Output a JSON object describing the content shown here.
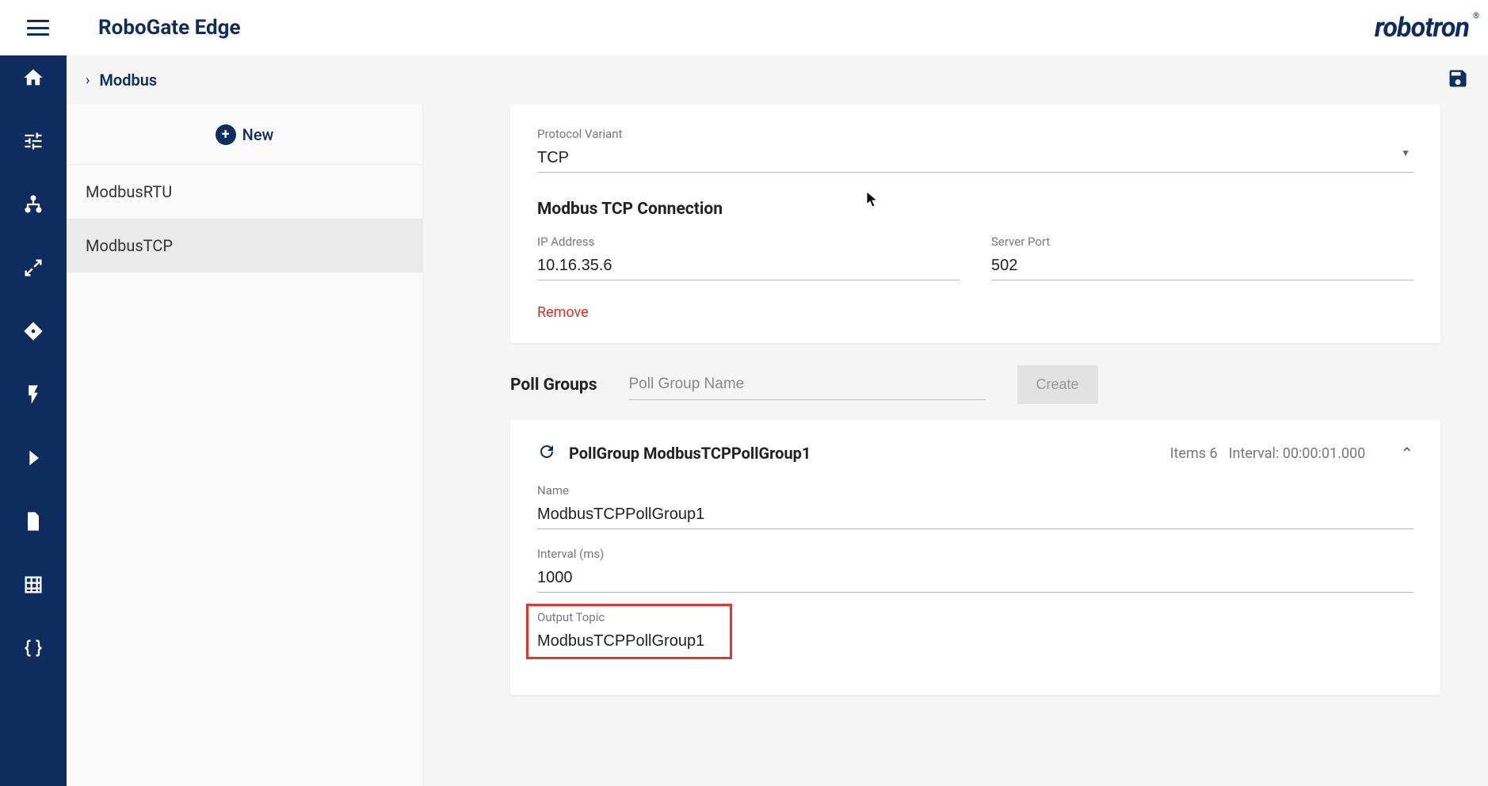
{
  "app_title": "RoboGate Edge",
  "brand": "robotron",
  "breadcrumb": "Modbus",
  "new_label": "New",
  "side_items": [
    {
      "label": "ModbusRTU",
      "selected": false
    },
    {
      "label": "ModbusTCP",
      "selected": true
    }
  ],
  "protocol": {
    "label": "Protocol Variant",
    "value": "TCP"
  },
  "connection": {
    "title": "Modbus TCP Connection",
    "ip_label": "IP Address",
    "ip_value": "10.16.35.6",
    "port_label": "Server Port",
    "port_value": "502",
    "remove_label": "Remove"
  },
  "pollgroups": {
    "title": "Poll Groups",
    "name_placeholder": "Poll Group Name",
    "create_label": "Create",
    "group": {
      "title": "PollGroup ModbusTCPPollGroup1",
      "items_label": "Items 6",
      "interval_label": "Interval: 00:00:01.000",
      "name_label": "Name",
      "name_value": "ModbusTCPPollGroup1",
      "interval_field_label": "Interval (ms)",
      "interval_value": "1000",
      "output_label": "Output Topic",
      "output_value": "ModbusTCPPollGroup1"
    }
  }
}
